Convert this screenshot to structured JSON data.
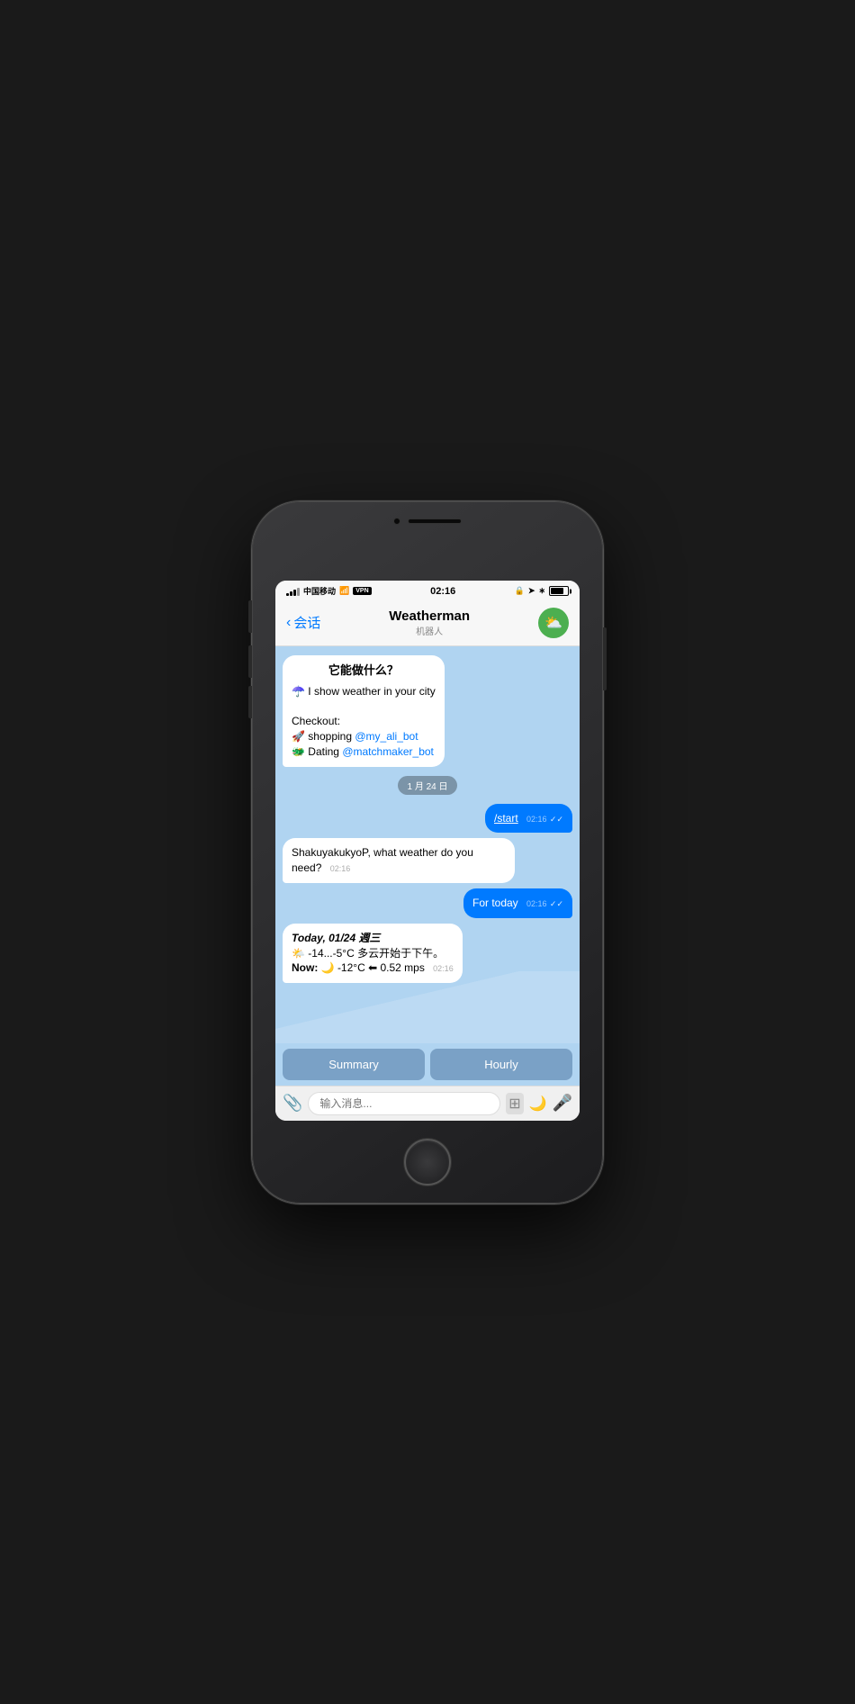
{
  "phone": {
    "status_bar": {
      "carrier": "中国移动",
      "wifi": "WiFi",
      "vpn": "VPN",
      "time": "02:16",
      "battery_level": 80
    },
    "nav": {
      "back_label": "会话",
      "title": "Weatherman",
      "subtitle": "机器人"
    },
    "chat": {
      "bot_intro": {
        "title": "它能做什么？",
        "line1_emoji": "☂️",
        "line1_text": "I show weather in your city",
        "checkout_label": "Checkout:",
        "shopping_emoji": "🚀",
        "shopping_text": "shopping ",
        "shopping_link": "@my_ali_bot",
        "dating_emoji": "🐲",
        "dating_text": "Dating ",
        "dating_link": "@matchmaker_bot"
      },
      "date_badge": "1 月 24 日",
      "messages": [
        {
          "id": "msg1",
          "type": "sent",
          "text": "/start",
          "time": "02:16",
          "ticks": "✓✓",
          "underline": true
        },
        {
          "id": "msg2",
          "type": "received",
          "text": "ShakuyakukyoP, what weather do you need?",
          "time": "02:16"
        },
        {
          "id": "msg3",
          "type": "sent",
          "text": "For today",
          "time": "02:16",
          "ticks": "✓✓"
        },
        {
          "id": "msg4",
          "type": "received",
          "text_italic_bold": "Today, 01/24 週三",
          "line2_emoji": "🌤️",
          "line2": "-14...-5°C 多云开始于下午。",
          "line3": "Now: 🌙 -12°C ⬅ 0.52 mps",
          "time": "02:16"
        }
      ],
      "quick_replies": [
        {
          "label": "Summary"
        },
        {
          "label": "Hourly"
        }
      ]
    },
    "input_bar": {
      "placeholder": "输入消息..."
    }
  }
}
